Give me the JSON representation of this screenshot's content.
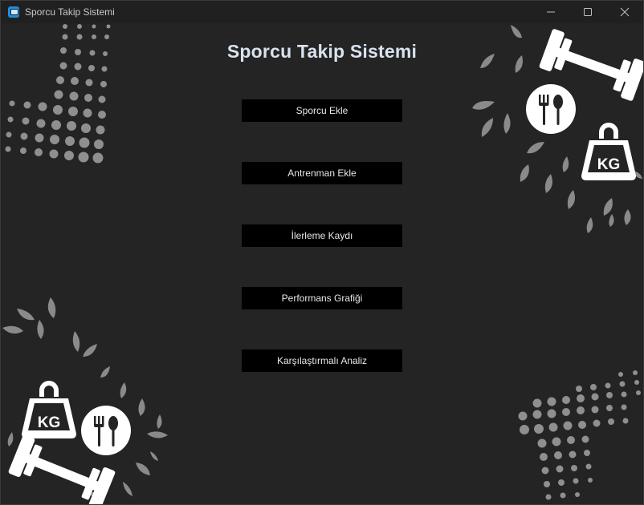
{
  "window": {
    "title": "Sporcu Takip Sistemi"
  },
  "icons": {
    "app": "app-icon",
    "minimize": "minimize-icon",
    "maximize": "maximize-icon",
    "close": "close-icon",
    "dumbbell": "dumbbell-icon",
    "kettlebell": "kettlebell-icon",
    "fork_spoon": "fork-spoon-icon"
  },
  "kettlebell_label": "KG",
  "main": {
    "title": "Sporcu Takip Sistemi",
    "buttons": [
      {
        "label": "Sporcu Ekle"
      },
      {
        "label": "Antrenman Ekle"
      },
      {
        "label": "İlerleme Kaydı"
      },
      {
        "label": "Performans Grafiği"
      },
      {
        "label": "Karşılaştırmalı Analiz"
      }
    ]
  },
  "colors": {
    "background": "#242424",
    "button_bg": "#000000",
    "title_text": "#d9e2ee",
    "decor_gray": "#8a8a8a",
    "decor_white": "#ffffff"
  }
}
